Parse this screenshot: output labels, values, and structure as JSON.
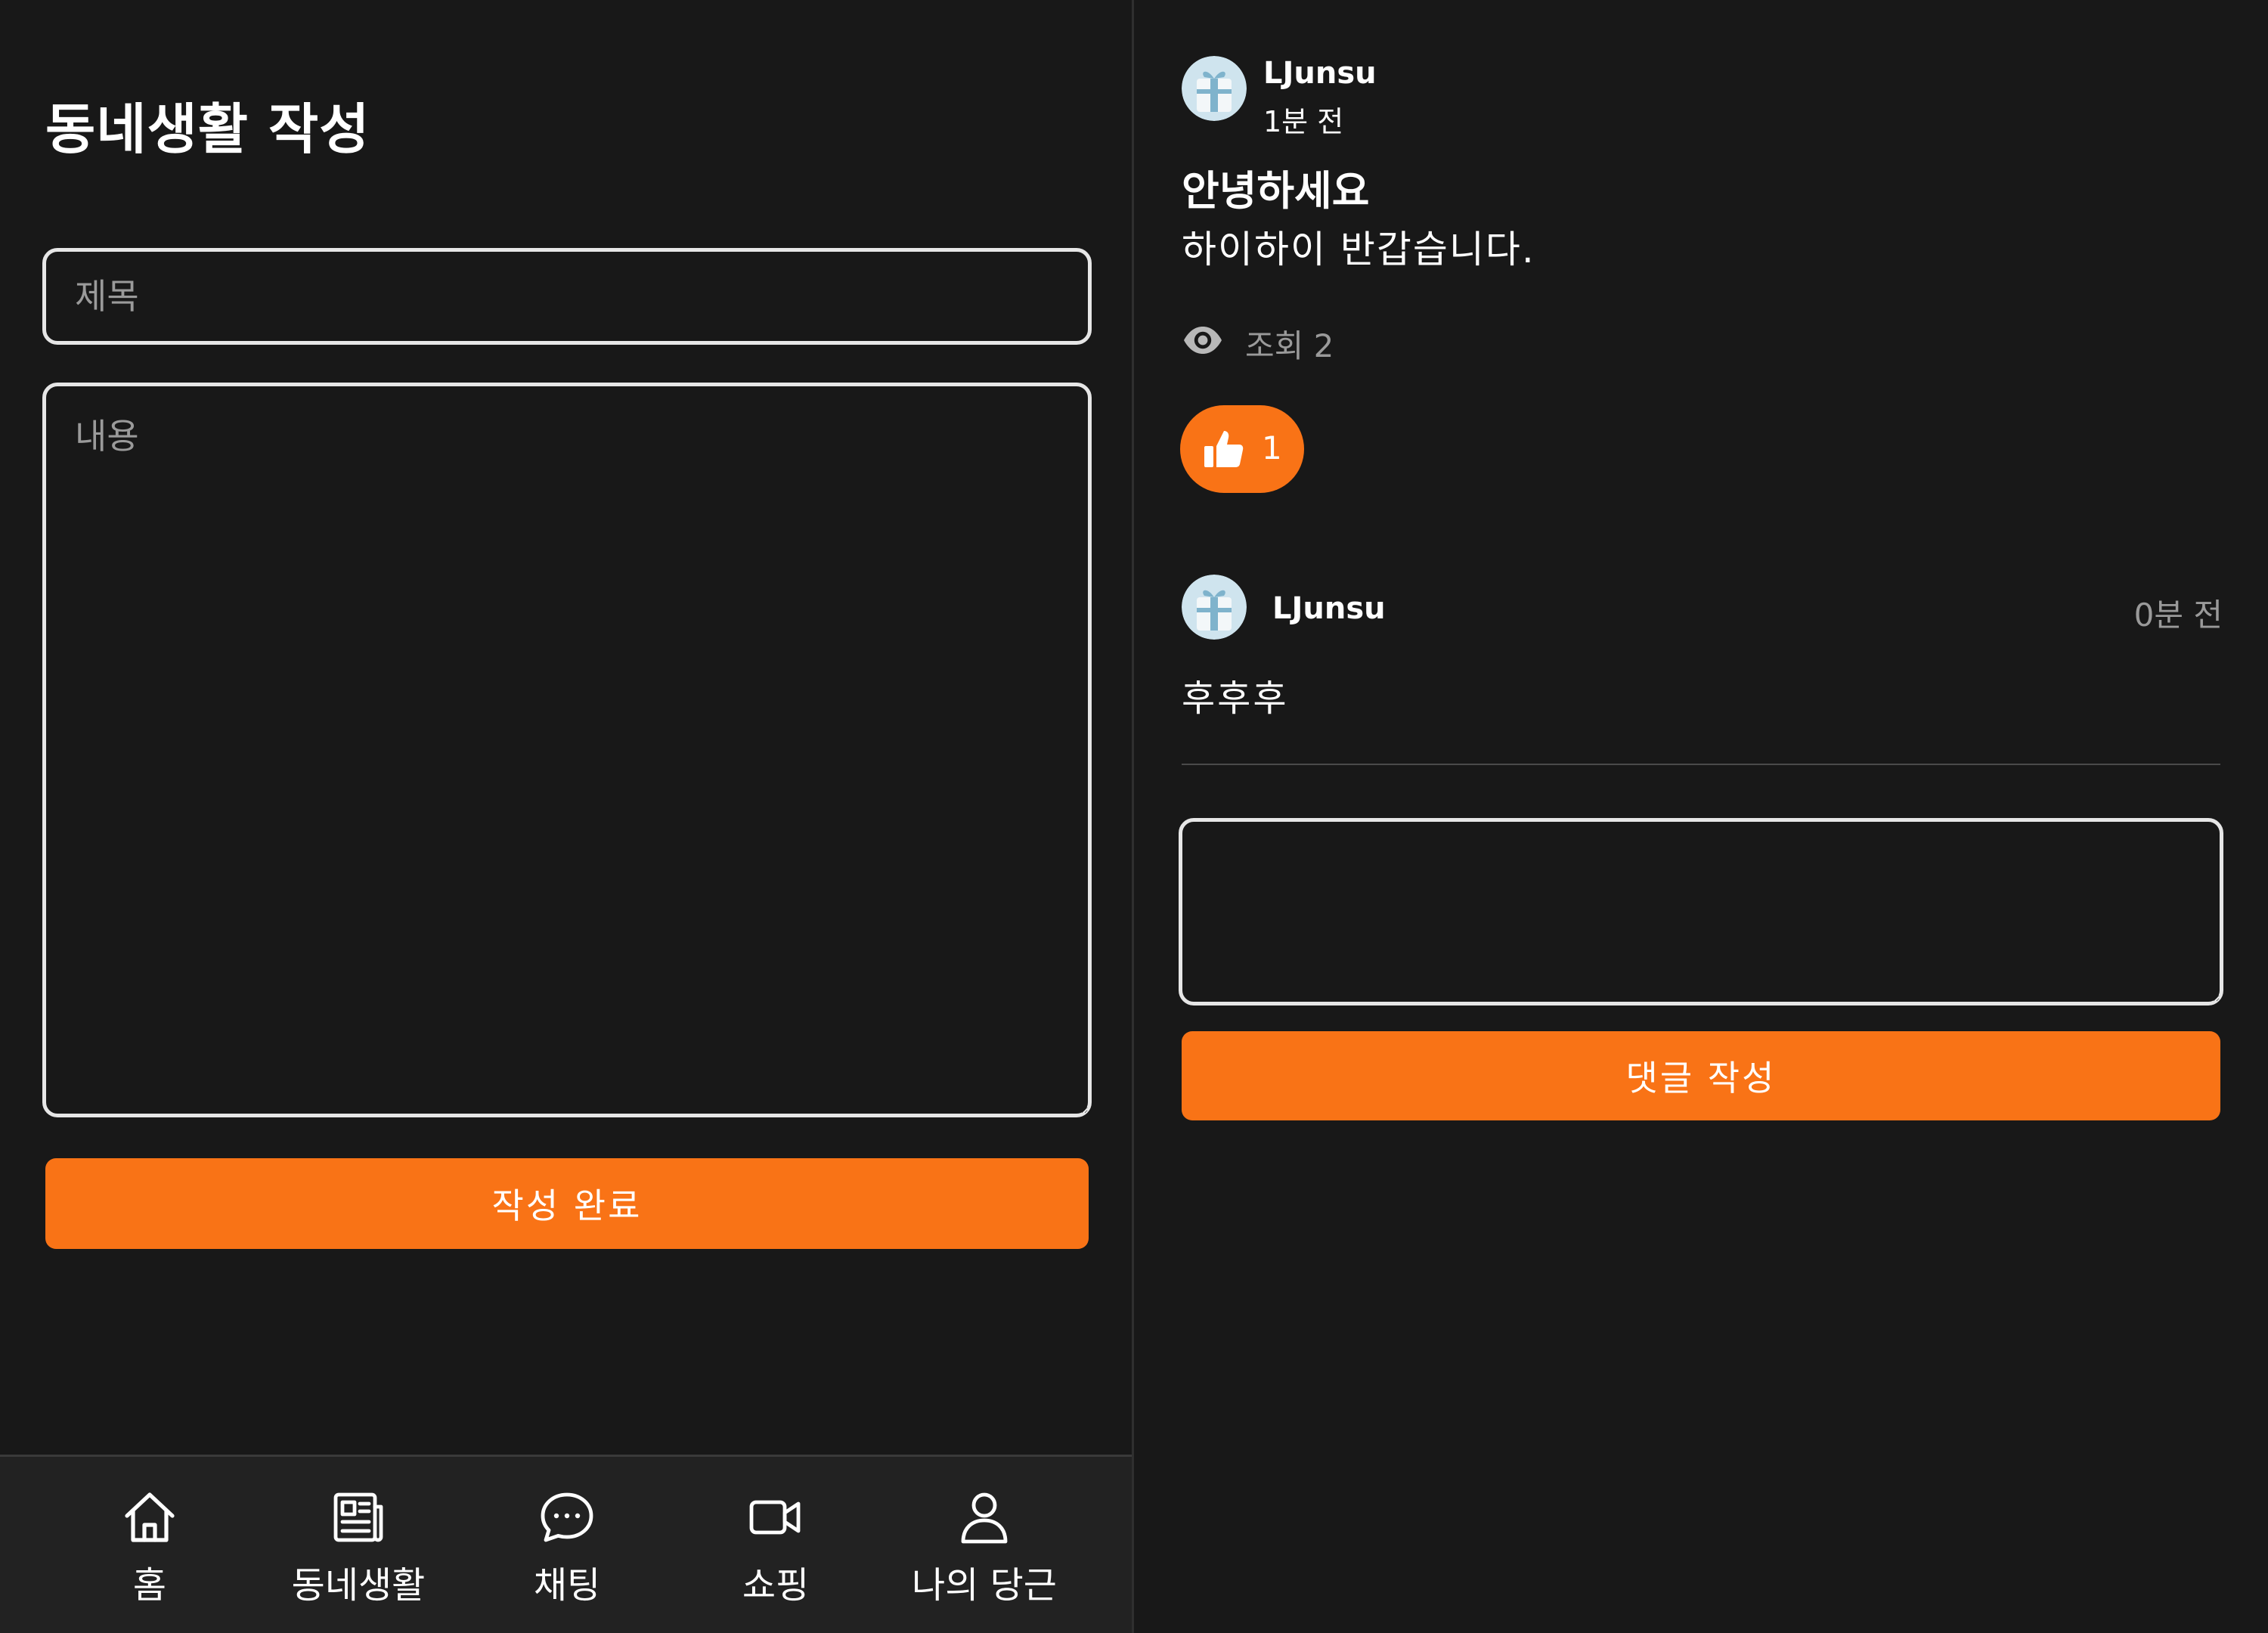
{
  "write_form": {
    "title": "동네생활 작성",
    "title_placeholder": "제목",
    "content_placeholder": "내용",
    "submit_label": "작성 완료"
  },
  "bottom_nav": {
    "items": [
      {
        "label": "홈",
        "icon": "home-icon"
      },
      {
        "label": "동네생활",
        "icon": "newspaper-icon"
      },
      {
        "label": "채팅",
        "icon": "chat-bubble-icon"
      },
      {
        "label": "쇼핑",
        "icon": "video-camera-icon"
      },
      {
        "label": "나의 당근",
        "icon": "user-icon"
      }
    ]
  },
  "post": {
    "author": "LJunsu",
    "time": "1분 전",
    "title": "안녕하세요",
    "body": "하이하이 반갑습니다.",
    "views_label": "조회 2",
    "like_count": "1"
  },
  "comments": [
    {
      "author": "LJunsu",
      "time": "0분 전",
      "text": "후후후"
    }
  ],
  "comment_form": {
    "value": "",
    "submit_label": "댓글 작성"
  },
  "colors": {
    "background": "#181818",
    "accent": "#f97316",
    "nav_background": "#222222",
    "muted_text": "#9a9a9a"
  }
}
